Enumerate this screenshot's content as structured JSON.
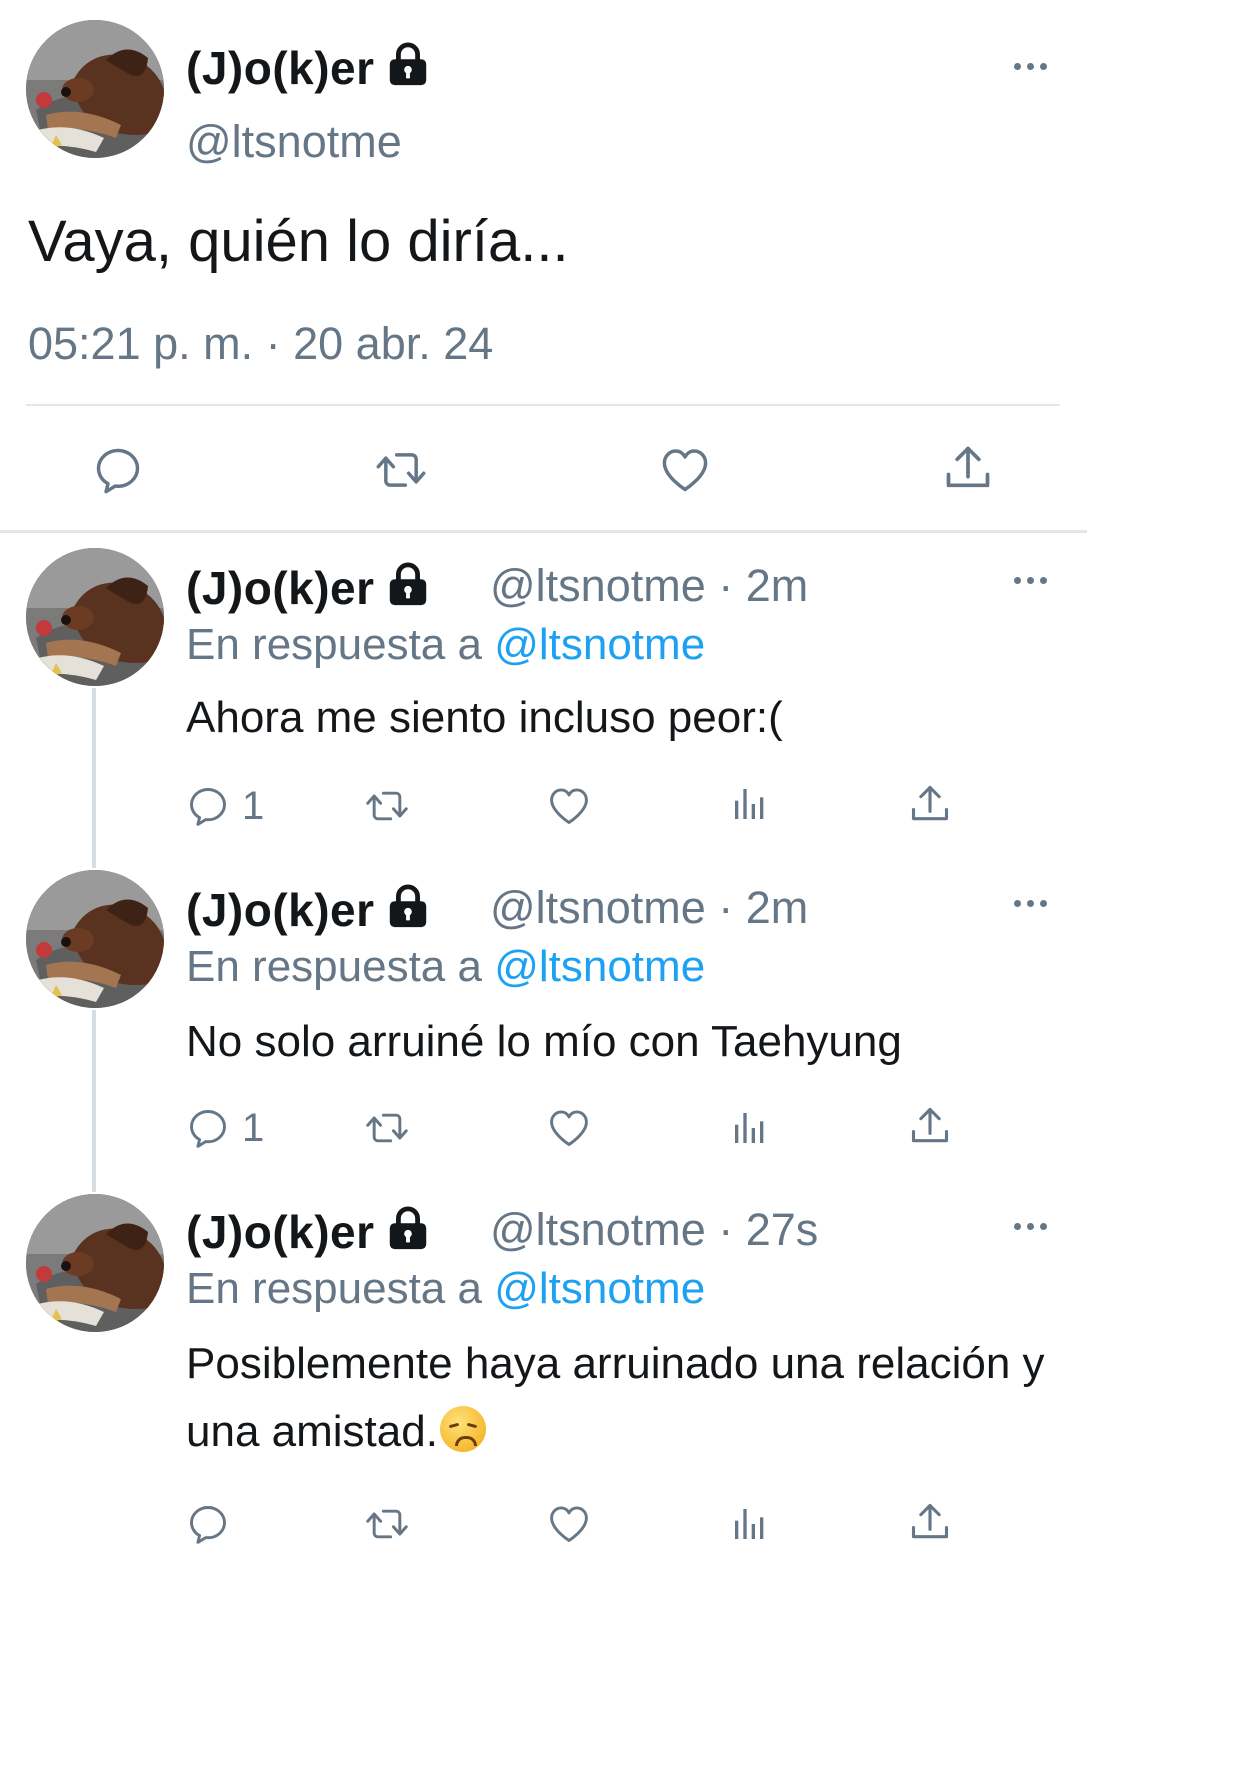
{
  "main_tweet": {
    "display_name": "(J)o(k)er",
    "handle": "@ltsnotme",
    "text": "Vaya, quién lo diría...",
    "timestamp": "05:21 p. m. · 20 abr. 24"
  },
  "replies": [
    {
      "display_name": "(J)o(k)er",
      "meta": "@ltsnotme · 2m",
      "reply_prefix": "En respuesta a",
      "reply_mention": "@ltsnotme",
      "text": "Ahora me siento incluso peor:(",
      "reply_count": "1"
    },
    {
      "display_name": "(J)o(k)er",
      "meta": "@ltsnotme · 2m",
      "reply_prefix": "En respuesta a",
      "reply_mention": "@ltsnotme",
      "text": "No solo arruiné lo mío con Taehyung",
      "reply_count": "1"
    },
    {
      "display_name": "(J)o(k)er",
      "meta": "@ltsnotme · 27s",
      "reply_prefix": "En respuesta a",
      "reply_mention": "@ltsnotme",
      "text": "Posiblemente haya arruinado una relación y una amistad.",
      "emoji": "disappointed-face-emoji"
    }
  ],
  "colors": {
    "text": "#14171a",
    "secondary": "#657786",
    "link": "#1da1f2",
    "divider": "#e1e8ed"
  },
  "icons": [
    "reply-icon",
    "retweet-icon",
    "like-icon",
    "share-icon",
    "analytics-icon",
    "lock-icon",
    "more-icon"
  ]
}
